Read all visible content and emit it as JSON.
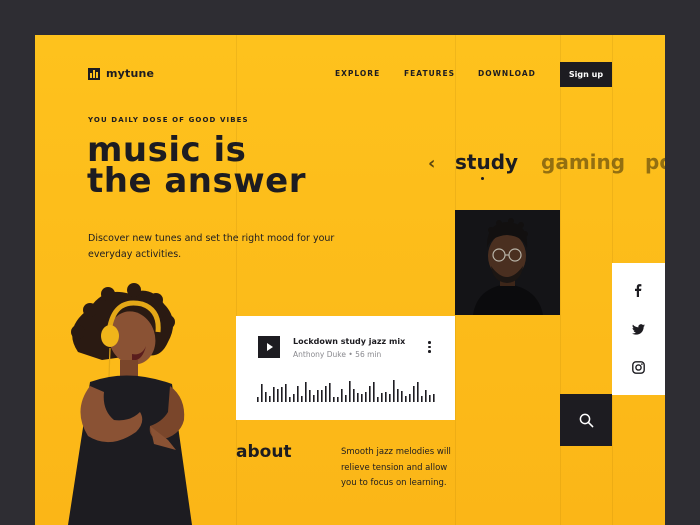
{
  "brand": {
    "name": "mytune"
  },
  "nav": {
    "items": [
      "EXPLORE",
      "FEATURES",
      "DOWNLOAD"
    ],
    "signup_label": "Sign up"
  },
  "hero": {
    "tagline": "YOU DAILY DOSE OF GOOD VIBES",
    "title_line1": "music is",
    "title_line2": "the answer",
    "subtitle": "Discover new tunes and set the right mood for your everyday activities."
  },
  "moods": {
    "items": [
      "study",
      "gaming",
      "po"
    ],
    "active": "study"
  },
  "player": {
    "track_title": "Lockdown study jazz mix",
    "artist": "Anthony Duke",
    "duration": "56 min"
  },
  "about": {
    "title": "about",
    "text": "Smooth jazz melodies will relieve tension and allow you to focus on learning."
  },
  "social": {
    "icons": [
      "facebook-icon",
      "twitter-icon",
      "instagram-icon"
    ]
  },
  "colors": {
    "accent": "#fec21d",
    "dark": "#1d1c21",
    "backdrop": "#2e2d33",
    "white": "#ffffff"
  }
}
